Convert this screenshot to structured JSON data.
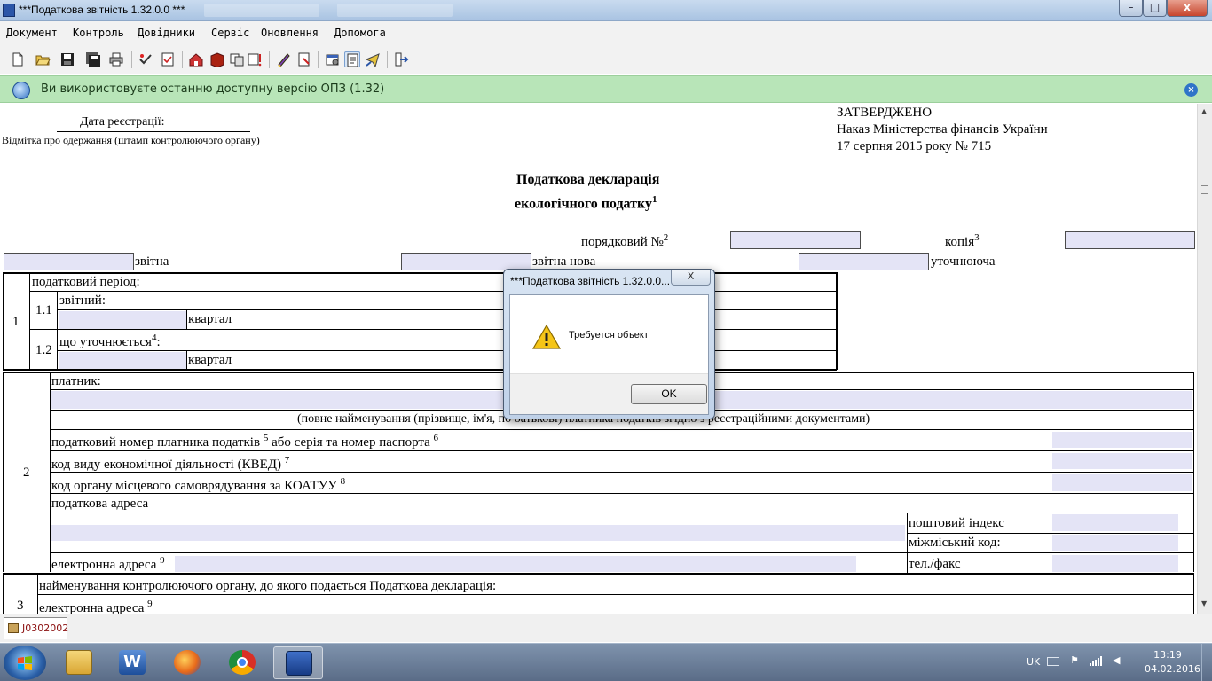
{
  "window": {
    "title": "***Податкова звітність 1.32.0.0 ***"
  },
  "menu": [
    "Документ",
    "Контроль",
    "Довідники",
    "Сервіс",
    "Оновлення",
    "Допомога"
  ],
  "toolbar_icons": [
    "new-document-icon",
    "open-folder-icon",
    "save-icon",
    "save-all-icon",
    "print-icon",
    "check-icon",
    "verify-icon",
    "home-icon",
    "book-icon",
    "copy-icon",
    "export-icon",
    "sign-icon",
    "encrypt-icon",
    "settings-icon",
    "list-icon",
    "send-icon",
    "exit-icon"
  ],
  "infobar": {
    "text": "Ви використовуєте останню доступну версію ОПЗ (1.32)"
  },
  "doc": {
    "reg_date": "Дата реєстрації:",
    "stamp_note": "Відмітка про одержання (штамп контролюючого органу)",
    "approved": "ЗАТВЕРДЖЕНО",
    "order": "Наказ Міністерства фінансів України",
    "order_date": "17 серпня 2015 року № 715",
    "title1": "Податкова декларація",
    "title2": "екологічного податку",
    "title_sup": "1",
    "ordinal": "порядковий №",
    "ordinal_sup": "2",
    "copy": "копія",
    "copy_sup": "3",
    "reporting": "звітна",
    "reporting_new": "звітна нова",
    "clarifying": "уточнююча",
    "row1": "1",
    "tax_period": "податковий період:",
    "r11": "1.1",
    "reporting_period": "звітний:",
    "quarter": "квартал",
    "r12": "1.2",
    "clarified": "що уточнюється",
    "clarified_sup": "4",
    "colon": ":",
    "row2": "2",
    "payer": "платник:",
    "fullname_note": "(повне найменування (прізвище, ім'я, по батькові) платника податків згідно з реєстраційними документами)",
    "tax_number": "податковий номер платника податків",
    "tax_number_sup": "5",
    "or_passport": "або серія та номер паспорта",
    "or_passport_sup": "6",
    "kved": "код виду економічної діяльності (КВЕД)",
    "kved_sup": "7",
    "koatuu": "код органу місцевого самоврядування за КОАТУУ",
    "koatuu_sup": "8",
    "tax_address": "податкова адреса",
    "postal": "поштовий індекс",
    "intercity": "міжміський код:",
    "email": "електронна адреса",
    "email_sup": "9",
    "phone": "тел./факс",
    "row3": "3",
    "control_body": "найменування контролюючого органу, до якого подається Податкова декларація:"
  },
  "tab": {
    "label": "J0302002"
  },
  "dialog": {
    "title": "***Податкова звітність 1.32.0.0...",
    "close": "X",
    "message": "Требуется объект",
    "ok": "OK"
  },
  "taskbar": {
    "apps": [
      "explorer-icon",
      "word-icon",
      "firefox-icon",
      "chrome-icon",
      "tax-reporting-icon"
    ],
    "language": "UK",
    "time": "13:19",
    "date": "04.02.2016"
  },
  "colors": {
    "field": "#e4e4f6",
    "infobar": "#b8e5b8",
    "accent": "#2f74c8"
  }
}
